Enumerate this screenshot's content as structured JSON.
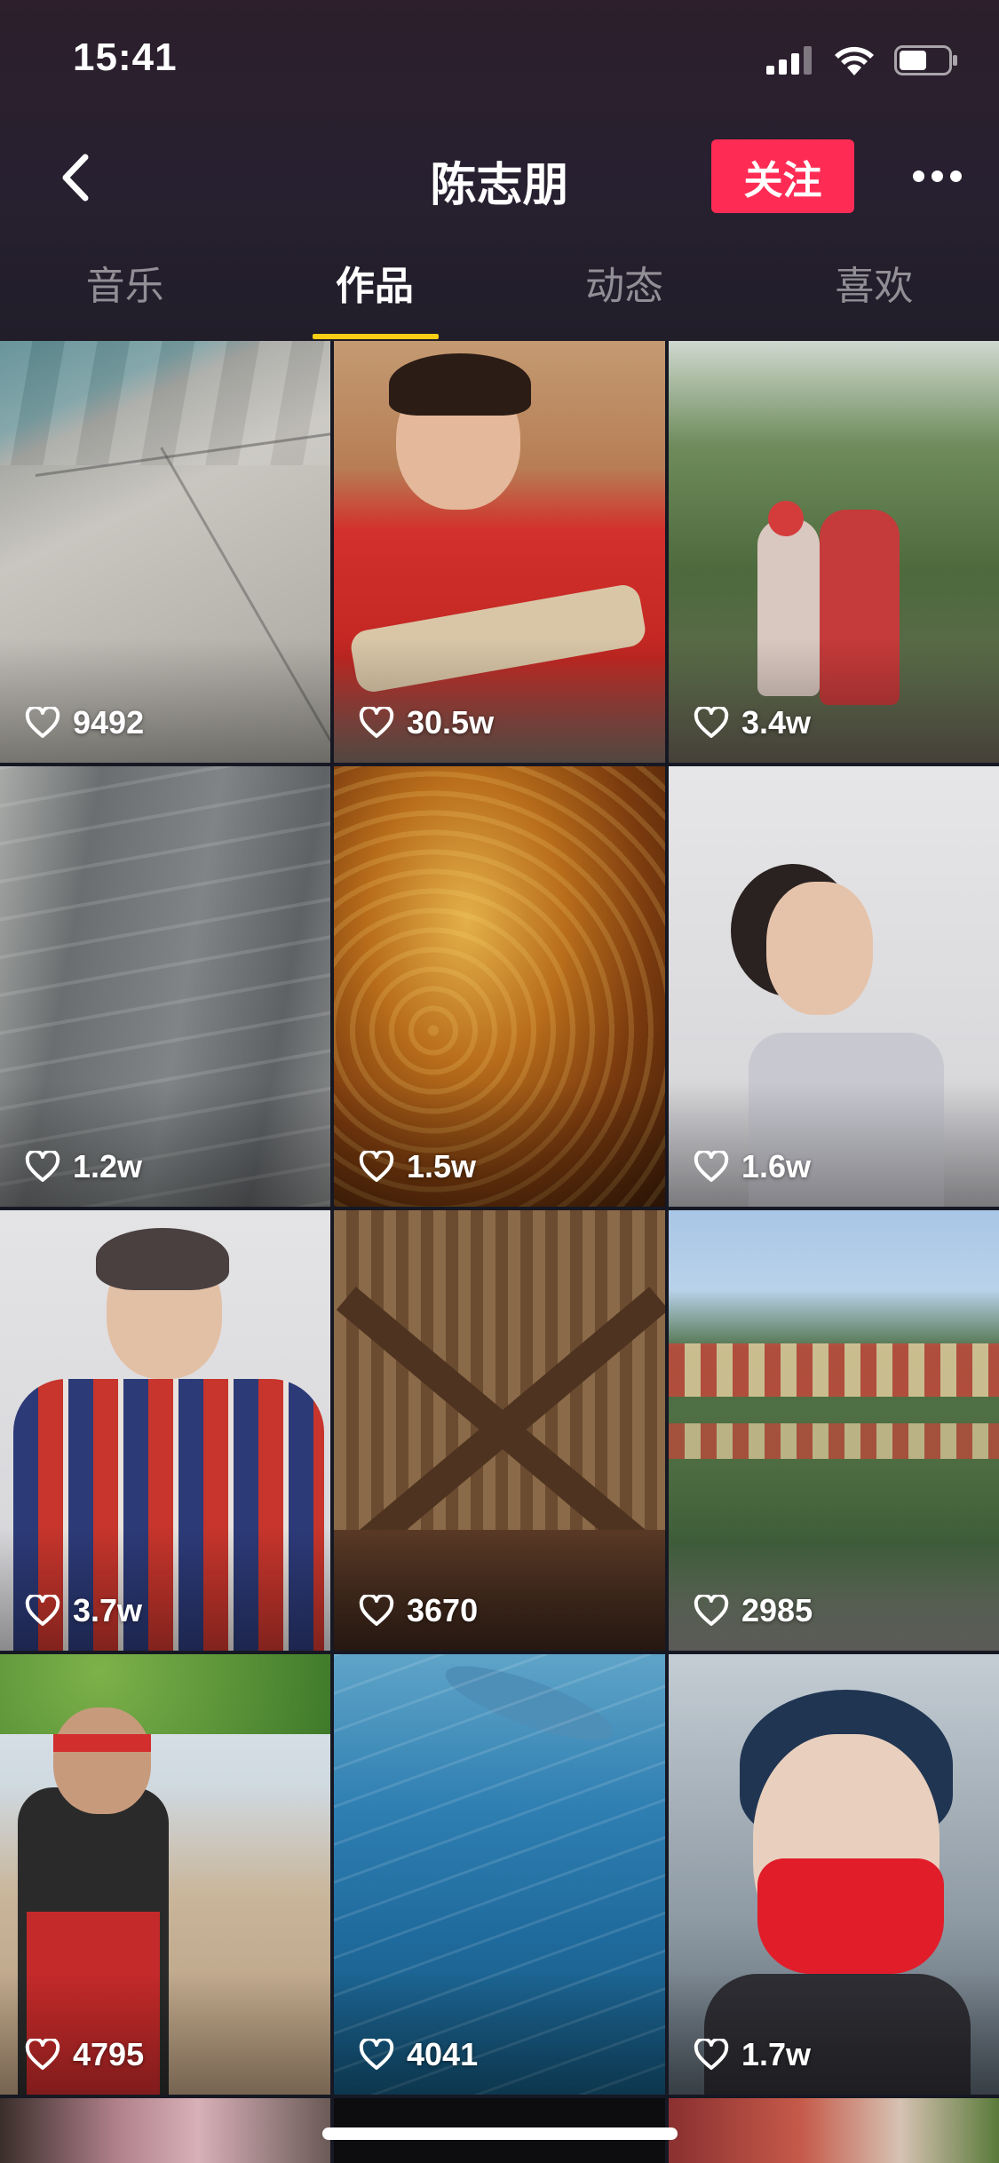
{
  "status_bar": {
    "time": "15:41"
  },
  "header": {
    "title": "陈志朋",
    "follow_label": "关注"
  },
  "tabs": [
    {
      "label": "音乐",
      "active": false
    },
    {
      "label": "作品",
      "active": true
    },
    {
      "label": "动态",
      "active": false
    },
    {
      "label": "喜欢",
      "active": false
    }
  ],
  "videos": [
    {
      "likes": "9492"
    },
    {
      "likes": "30.5w"
    },
    {
      "likes": "3.4w"
    },
    {
      "likes": "1.2w"
    },
    {
      "likes": "1.5w"
    },
    {
      "likes": "1.6w"
    },
    {
      "likes": "3.7w"
    },
    {
      "likes": "3670"
    },
    {
      "likes": "2985"
    },
    {
      "likes": "4795"
    },
    {
      "likes": "4041"
    },
    {
      "likes": "1.7w"
    }
  ],
  "colors": {
    "accent": "#fe2c55",
    "tab_indicator": "#face15",
    "background": "#161823"
  },
  "icons": {
    "back": "chevron-left-icon",
    "more": "more-horizontal-icon",
    "like": "heart-outline-icon"
  }
}
